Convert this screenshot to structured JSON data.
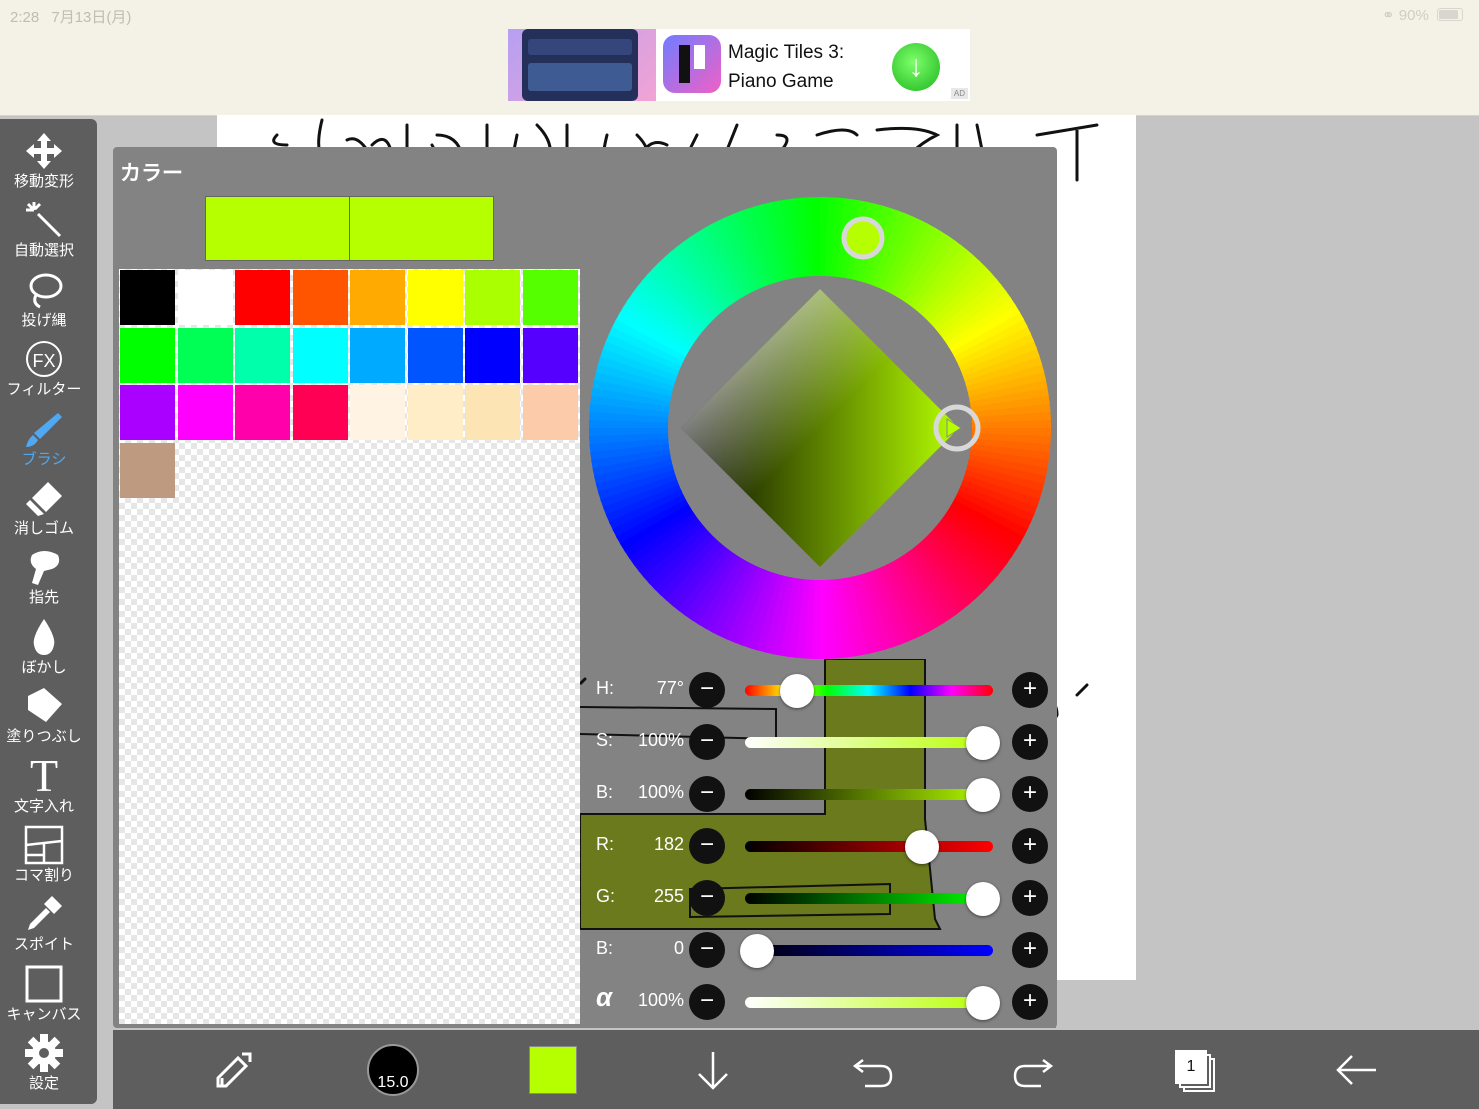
{
  "status_bar": {
    "time": "2:28",
    "date": "7月13日(月)",
    "battery": "90%"
  },
  "ad": {
    "title": "Magic Tiles 3: Piano Game",
    "badge": "AD"
  },
  "tools": [
    {
      "label": "移動変形",
      "icon": "move-icon"
    },
    {
      "label": "自動選択",
      "icon": "magic-wand-icon"
    },
    {
      "label": "投げ縄",
      "icon": "lasso-icon"
    },
    {
      "label": "フィルター",
      "icon": "filter-fx-icon",
      "glyph": "FX"
    },
    {
      "label": "ブラシ",
      "icon": "brush-icon",
      "active": true
    },
    {
      "label": "消しゴム",
      "icon": "eraser-icon"
    },
    {
      "label": "指先",
      "icon": "finger-icon"
    },
    {
      "label": "ぼかし",
      "icon": "blur-drop-icon"
    },
    {
      "label": "塗りつぶし",
      "icon": "bucket-icon"
    },
    {
      "label": "文字入れ",
      "icon": "text-icon",
      "glyph": "T"
    },
    {
      "label": "コマ割り",
      "icon": "frame-divide-icon"
    },
    {
      "label": "スポイト",
      "icon": "eyedropper-icon"
    },
    {
      "label": "キャンバス",
      "icon": "canvas-icon"
    },
    {
      "label": "設定",
      "icon": "gear-icon"
    }
  ],
  "color_panel": {
    "title": "カラー",
    "current_color": "#b6ff00",
    "previous_color": "#b6ff00",
    "palette": [
      "#000000",
      "#ffffff",
      "#ff0000",
      "#ff5500",
      "#ffaa00",
      "#ffff00",
      "#aaff00",
      "#55ff00",
      "#00ff00",
      "#00ff55",
      "#00ffaa",
      "#00ffff",
      "#00aaff",
      "#0055ff",
      "#0000ff",
      "#5500ff",
      "#aa00ff",
      "#ff00ff",
      "#ff00aa",
      "#ff0055",
      "#fff4e4",
      "#ffedc8",
      "#fde4b4",
      "#fcccaa",
      "#bd9a80"
    ],
    "sliders": [
      {
        "label": "H:",
        "value": "77°",
        "fraction": 0.21,
        "track": "hue",
        "icon": ""
      },
      {
        "label": "S:",
        "value": "100%",
        "fraction": 1.0,
        "track": "sat",
        "icon": ""
      },
      {
        "label": "B:",
        "value": "100%",
        "fraction": 1.0,
        "track": "bri",
        "icon": ""
      },
      {
        "label": "R:",
        "value": "182",
        "fraction": 0.714,
        "track": "red",
        "icon": ""
      },
      {
        "label": "G:",
        "value": "255",
        "fraction": 1.0,
        "track": "green",
        "icon": ""
      },
      {
        "label": "B:",
        "value": "0",
        "fraction": 0.0,
        "track": "blue",
        "icon": ""
      },
      {
        "label": "α",
        "value": "100%",
        "fraction": 1.0,
        "track": "alpha",
        "icon": "alpha-icon"
      }
    ],
    "minus_glyph": "−",
    "plus_glyph": "+"
  },
  "bottom_bar": {
    "brush_size": "15.0",
    "current_color": "#b6ff00",
    "layer_count": "1"
  }
}
